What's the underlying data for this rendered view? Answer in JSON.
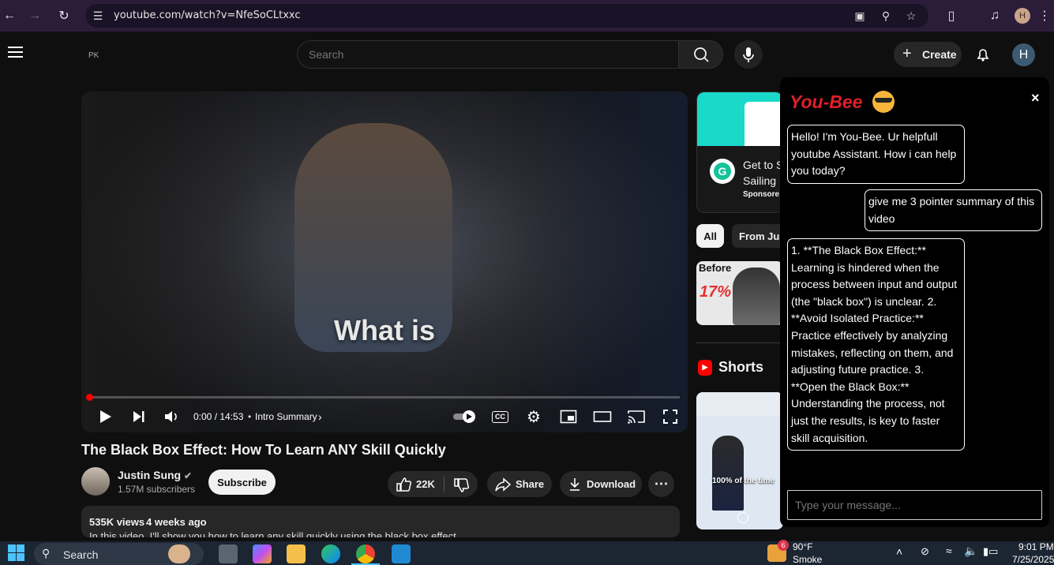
{
  "browser": {
    "url": "youtube.com/watch?v=NfeSoCLtxxc",
    "profile_initial": "H"
  },
  "header": {
    "country_code": "PK",
    "search_placeholder": "Search",
    "create_label": "Create",
    "avatar_initial": "H"
  },
  "player": {
    "caption_text": "What is",
    "time": "0:00 / 14:53",
    "chapter": "Intro Summary",
    "progress": 0.0
  },
  "video": {
    "title": "The Black Box Effect: How To Learn ANY Skill Quickly",
    "channel": "Justin Sung",
    "subscribers": "1.57M subscribers",
    "subscribe_label": "Subscribe",
    "likes": "22K",
    "share_label": "Share",
    "download_label": "Download",
    "views": "535K views",
    "age": "4 weeks ago",
    "desc_snippet": "In this video, I'll show you how to learn any skill quickly using the black box effect"
  },
  "sidebar": {
    "ad_text_1": "Get to S",
    "ad_text_2": "Sailing",
    "ad_sponsored": "Sponsore",
    "chip_all": "All",
    "chip_from": "From Jus",
    "thumb_before": "Before",
    "thumb_percent": "17%",
    "shorts_label": "Shorts",
    "short_caption": "100% of the time"
  },
  "youbee": {
    "title": "You-Bee",
    "close": "×",
    "messages": [
      "Hello! I'm You-Bee. Ur helpfull youtube Assistant. How i can help you today?",
      "give me 3 pointer summary of this video",
      "1. **The Black Box Effect:** Learning is hindered when the process between input and output (the \"black box\") is unclear. 2. **Avoid Isolated Practice:** Practice effectively by analyzing mistakes, reflecting on them, and adjusting future practice. 3. **Open the Black Box:** Understanding the process, not just the results, is key to faster skill acquisition."
    ],
    "input_placeholder": "Type your message..."
  },
  "taskbar": {
    "search_label": "Search",
    "weather_badge": "6",
    "temperature": "90°F",
    "weather": "Smoke",
    "time": "9:01 PM",
    "date": "7/25/2025"
  },
  "colors": {
    "brand_red": "#e0202a",
    "chrome_bg": "#2b1d3a",
    "page_bg": "#0f0f0f",
    "progress_red": "#ff0000"
  }
}
